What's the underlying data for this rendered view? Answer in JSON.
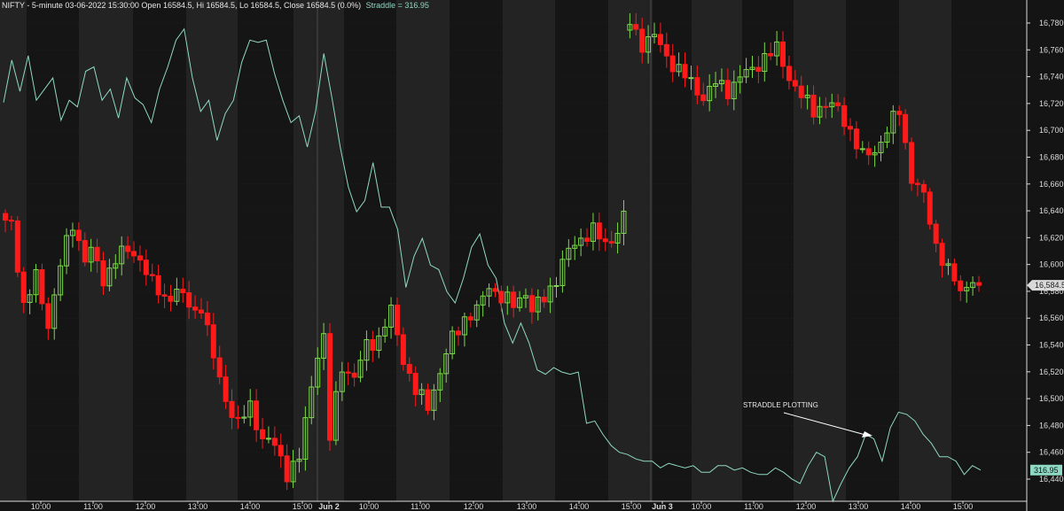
{
  "header": {
    "symbol_info": "NIFTY - 5-minute 03-06-2022 15:30:00 Open 16584.5, Hi 16584.5, Lo 16584.5, Close 16584.5 (0.0%)",
    "straddle_info": "Straddle = 316.95"
  },
  "chart_data": {
    "type": "candlestick",
    "title": "NIFTY - 5-minute",
    "ylim": [
      16420,
      16800
    ],
    "y_ticks": [
      16440,
      16460,
      16480,
      16500,
      16520,
      16540,
      16560,
      16580,
      16600,
      16620,
      16640,
      16660,
      16680,
      16700,
      16720,
      16740,
      16760,
      16780
    ],
    "x_ticks": [
      "10:00",
      "11:00",
      "12:00",
      "13:00",
      "14:00",
      "15:00",
      "Jun 2",
      "10:00",
      "11:00",
      "12:00",
      "13:00",
      "14:00",
      "15:00",
      "Jun 3",
      "10:00",
      "11:00",
      "12:00",
      "13:00",
      "14:00",
      "15:00"
    ],
    "price_label": "16,584.5",
    "straddle_label": "316.95",
    "annotation": "STRADDLE PLOTTING",
    "colors": {
      "up": "#7cd94a",
      "down": "#ff1a1a",
      "straddle": "#8fd9c4",
      "grid": "#3a3a3a",
      "axis": "#dcdcdc",
      "band_light": "#232323",
      "band_dark": "#151515"
    },
    "series": [
      {
        "name": "NIFTY",
        "close_path": [
          [
            1,
            16630
          ],
          [
            3,
            16570
          ],
          [
            5,
            16590
          ],
          [
            7,
            16555
          ],
          [
            9,
            16600
          ],
          [
            11,
            16630
          ],
          [
            13,
            16605
          ],
          [
            14,
            16610
          ],
          [
            16,
            16588
          ],
          [
            18,
            16605
          ],
          [
            20,
            16610
          ],
          [
            22,
            16605
          ],
          [
            24,
            16585
          ],
          [
            26,
            16575
          ],
          [
            28,
            16580
          ],
          [
            29,
            16575
          ],
          [
            31,
            16565
          ],
          [
            32,
            16570
          ],
          [
            34,
            16530
          ],
          [
            36,
            16500
          ],
          [
            38,
            16480
          ],
          [
            40,
            16495
          ],
          [
            42,
            16470
          ],
          [
            44,
            16465
          ],
          [
            46,
            16445
          ],
          [
            48,
            16455
          ],
          [
            50,
            16510
          ],
          [
            51,
            16535
          ],
          [
            52,
            16545
          ],
          [
            53,
            16470
          ],
          [
            54,
            16500
          ],
          [
            55,
            16525
          ],
          [
            57,
            16515
          ],
          [
            59,
            16540
          ],
          [
            61,
            16545
          ],
          [
            63,
            16565
          ],
          [
            65,
            16530
          ],
          [
            67,
            16505
          ],
          [
            69,
            16495
          ],
          [
            71,
            16520
          ],
          [
            73,
            16545
          ],
          [
            75,
            16560
          ],
          [
            77,
            16565
          ],
          [
            79,
            16585
          ],
          [
            81,
            16575
          ],
          [
            83,
            16570
          ],
          [
            85,
            16580
          ],
          [
            86,
            16565
          ],
          [
            88,
            16575
          ],
          [
            90,
            16590
          ],
          [
            92,
            16610
          ],
          [
            94,
            16620
          ],
          [
            96,
            16625
          ],
          [
            98,
            16615
          ],
          [
            100,
            16625
          ],
          [
            101,
            16635
          ],
          [
            102,
            16780
          ],
          [
            104,
            16765
          ],
          [
            106,
            16770
          ],
          [
            108,
            16755
          ],
          [
            110,
            16745
          ],
          [
            112,
            16735
          ],
          [
            114,
            16725
          ],
          [
            116,
            16735
          ],
          [
            118,
            16730
          ],
          [
            120,
            16740
          ],
          [
            122,
            16745
          ],
          [
            124,
            16755
          ],
          [
            126,
            16760
          ],
          [
            128,
            16740
          ],
          [
            130,
            16725
          ],
          [
            132,
            16715
          ],
          [
            134,
            16720
          ],
          [
            136,
            16715
          ],
          [
            138,
            16700
          ],
          [
            140,
            16680
          ],
          [
            142,
            16685
          ],
          [
            144,
            16700
          ],
          [
            146,
            16715
          ],
          [
            148,
            16665
          ],
          [
            150,
            16650
          ],
          [
            152,
            16615
          ],
          [
            154,
            16595
          ],
          [
            156,
            16580
          ],
          [
            158,
            16590
          ],
          [
            159,
            16584.5
          ]
        ]
      },
      {
        "name": "Straddle",
        "values": [
          329,
          348,
          334,
          350,
          330,
          335,
          340,
          321,
          330,
          327,
          343,
          345,
          330,
          335,
          322,
          340,
          331,
          328,
          320,
          335,
          345,
          357,
          362,
          340,
          325,
          330,
          312,
          324,
          330,
          347,
          357,
          356,
          357,
          342,
          330,
          320,
          323,
          309,
          325,
          351,
          331,
          309,
          291,
          280,
          285,
          302,
          282,
          282,
          272,
          246,
          260,
          268,
          256,
          254,
          244,
          239,
          250,
          264,
          270,
          256,
          250,
          230,
          221,
          230,
          221,
          209,
          207,
          210,
          208,
          207,
          208,
          185,
          186,
          180,
          175,
          172,
          171,
          169,
          168,
          168,
          165,
          167,
          166,
          165,
          166,
          163,
          163,
          166,
          166,
          164,
          165,
          163,
          162,
          162,
          165,
          163,
          160,
          158,
          166,
          172,
          170,
          150,
          158,
          165,
          170,
          180,
          178,
          168,
          183,
          190,
          189,
          186,
          180,
          176,
          170,
          170,
          168,
          162,
          166,
          164
        ]
      }
    ]
  }
}
